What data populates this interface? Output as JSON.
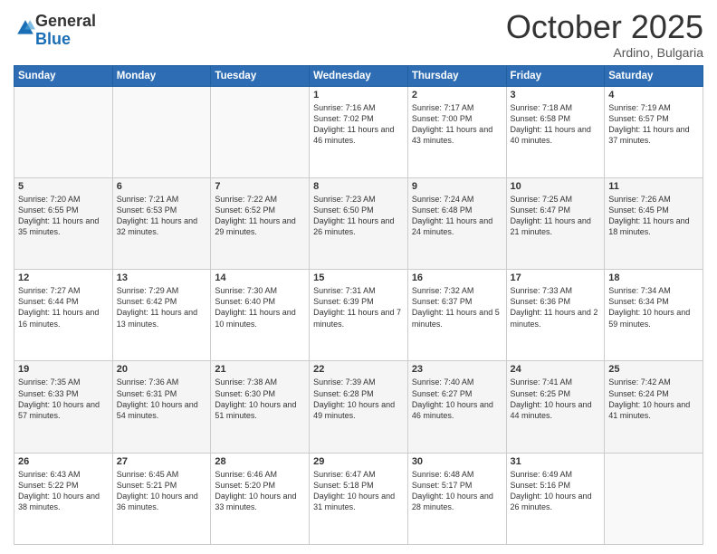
{
  "logo": {
    "line1": "General",
    "line2": "Blue"
  },
  "title": "October 2025",
  "location": "Ardino, Bulgaria",
  "days_of_week": [
    "Sunday",
    "Monday",
    "Tuesday",
    "Wednesday",
    "Thursday",
    "Friday",
    "Saturday"
  ],
  "weeks": [
    [
      {
        "day": "",
        "sunrise": "",
        "sunset": "",
        "daylight": ""
      },
      {
        "day": "",
        "sunrise": "",
        "sunset": "",
        "daylight": ""
      },
      {
        "day": "",
        "sunrise": "",
        "sunset": "",
        "daylight": ""
      },
      {
        "day": "1",
        "sunrise": "7:16 AM",
        "sunset": "7:02 PM",
        "daylight": "11 hours and 46 minutes."
      },
      {
        "day": "2",
        "sunrise": "7:17 AM",
        "sunset": "7:00 PM",
        "daylight": "11 hours and 43 minutes."
      },
      {
        "day": "3",
        "sunrise": "7:18 AM",
        "sunset": "6:58 PM",
        "daylight": "11 hours and 40 minutes."
      },
      {
        "day": "4",
        "sunrise": "7:19 AM",
        "sunset": "6:57 PM",
        "daylight": "11 hours and 37 minutes."
      }
    ],
    [
      {
        "day": "5",
        "sunrise": "7:20 AM",
        "sunset": "6:55 PM",
        "daylight": "11 hours and 35 minutes."
      },
      {
        "day": "6",
        "sunrise": "7:21 AM",
        "sunset": "6:53 PM",
        "daylight": "11 hours and 32 minutes."
      },
      {
        "day": "7",
        "sunrise": "7:22 AM",
        "sunset": "6:52 PM",
        "daylight": "11 hours and 29 minutes."
      },
      {
        "day": "8",
        "sunrise": "7:23 AM",
        "sunset": "6:50 PM",
        "daylight": "11 hours and 26 minutes."
      },
      {
        "day": "9",
        "sunrise": "7:24 AM",
        "sunset": "6:48 PM",
        "daylight": "11 hours and 24 minutes."
      },
      {
        "day": "10",
        "sunrise": "7:25 AM",
        "sunset": "6:47 PM",
        "daylight": "11 hours and 21 minutes."
      },
      {
        "day": "11",
        "sunrise": "7:26 AM",
        "sunset": "6:45 PM",
        "daylight": "11 hours and 18 minutes."
      }
    ],
    [
      {
        "day": "12",
        "sunrise": "7:27 AM",
        "sunset": "6:44 PM",
        "daylight": "11 hours and 16 minutes."
      },
      {
        "day": "13",
        "sunrise": "7:29 AM",
        "sunset": "6:42 PM",
        "daylight": "11 hours and 13 minutes."
      },
      {
        "day": "14",
        "sunrise": "7:30 AM",
        "sunset": "6:40 PM",
        "daylight": "11 hours and 10 minutes."
      },
      {
        "day": "15",
        "sunrise": "7:31 AM",
        "sunset": "6:39 PM",
        "daylight": "11 hours and 7 minutes."
      },
      {
        "day": "16",
        "sunrise": "7:32 AM",
        "sunset": "6:37 PM",
        "daylight": "11 hours and 5 minutes."
      },
      {
        "day": "17",
        "sunrise": "7:33 AM",
        "sunset": "6:36 PM",
        "daylight": "11 hours and 2 minutes."
      },
      {
        "day": "18",
        "sunrise": "7:34 AM",
        "sunset": "6:34 PM",
        "daylight": "10 hours and 59 minutes."
      }
    ],
    [
      {
        "day": "19",
        "sunrise": "7:35 AM",
        "sunset": "6:33 PM",
        "daylight": "10 hours and 57 minutes."
      },
      {
        "day": "20",
        "sunrise": "7:36 AM",
        "sunset": "6:31 PM",
        "daylight": "10 hours and 54 minutes."
      },
      {
        "day": "21",
        "sunrise": "7:38 AM",
        "sunset": "6:30 PM",
        "daylight": "10 hours and 51 minutes."
      },
      {
        "day": "22",
        "sunrise": "7:39 AM",
        "sunset": "6:28 PM",
        "daylight": "10 hours and 49 minutes."
      },
      {
        "day": "23",
        "sunrise": "7:40 AM",
        "sunset": "6:27 PM",
        "daylight": "10 hours and 46 minutes."
      },
      {
        "day": "24",
        "sunrise": "7:41 AM",
        "sunset": "6:25 PM",
        "daylight": "10 hours and 44 minutes."
      },
      {
        "day": "25",
        "sunrise": "7:42 AM",
        "sunset": "6:24 PM",
        "daylight": "10 hours and 41 minutes."
      }
    ],
    [
      {
        "day": "26",
        "sunrise": "6:43 AM",
        "sunset": "5:22 PM",
        "daylight": "10 hours and 38 minutes."
      },
      {
        "day": "27",
        "sunrise": "6:45 AM",
        "sunset": "5:21 PM",
        "daylight": "10 hours and 36 minutes."
      },
      {
        "day": "28",
        "sunrise": "6:46 AM",
        "sunset": "5:20 PM",
        "daylight": "10 hours and 33 minutes."
      },
      {
        "day": "29",
        "sunrise": "6:47 AM",
        "sunset": "5:18 PM",
        "daylight": "10 hours and 31 minutes."
      },
      {
        "day": "30",
        "sunrise": "6:48 AM",
        "sunset": "5:17 PM",
        "daylight": "10 hours and 28 minutes."
      },
      {
        "day": "31",
        "sunrise": "6:49 AM",
        "sunset": "5:16 PM",
        "daylight": "10 hours and 26 minutes."
      },
      {
        "day": "",
        "sunrise": "",
        "sunset": "",
        "daylight": ""
      }
    ]
  ],
  "labels": {
    "sunrise": "Sunrise:",
    "sunset": "Sunset:",
    "daylight": "Daylight:"
  }
}
